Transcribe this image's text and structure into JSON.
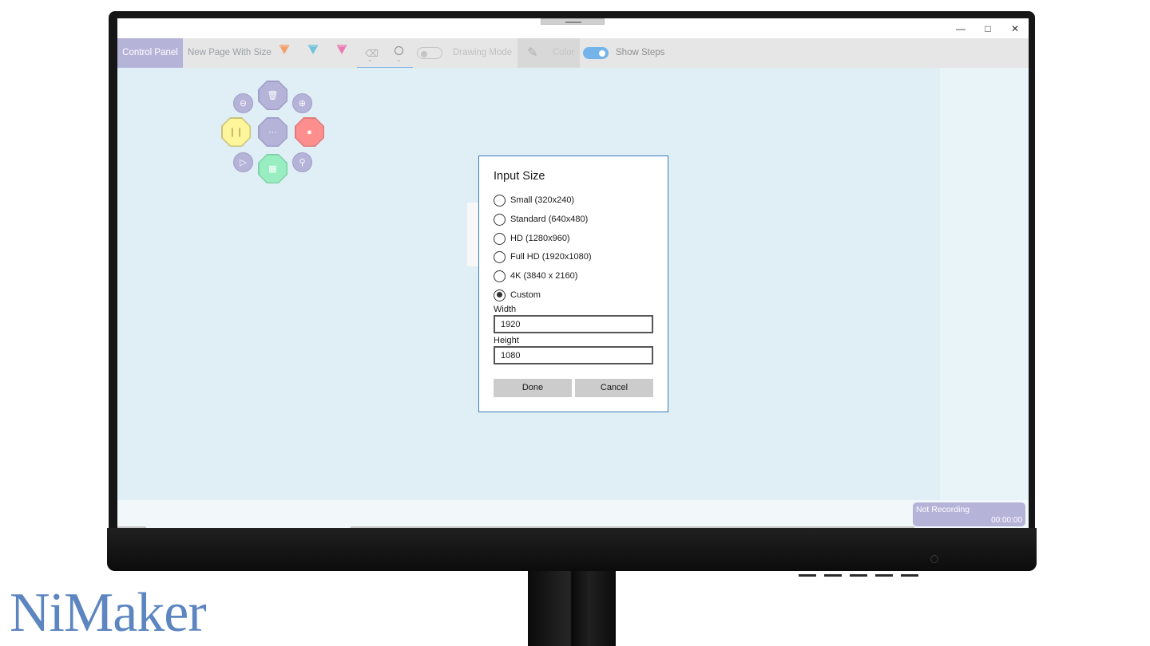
{
  "window": {
    "minimize_glyph": "—",
    "maximize_glyph": "□",
    "close_glyph": "✕"
  },
  "toolbar": {
    "control_panel_label": "Control Panel",
    "new_page_label": "New Page With Size",
    "drawing_mode_label": "Drawing Mode",
    "color_label": "Color",
    "show_steps_label": "Show Steps",
    "drawing_mode_on": false,
    "show_steps_on": true,
    "marker_colors": [
      "#f2a06b",
      "#6fc3da",
      "#e97ab5"
    ]
  },
  "control_pad": {
    "colors": {
      "purple": "#b6b3d9",
      "yellow": "#fff59a",
      "red": "#ff8f8f",
      "green": "#98edc1"
    },
    "icons": [
      "zoom-out-icon",
      "trash-icon",
      "zoom-in-icon",
      "pause-icon",
      "more-icon",
      "record-icon",
      "play-icon",
      "save-icon",
      "search-icon"
    ]
  },
  "dialog": {
    "title": "Input Size",
    "options": [
      {
        "label": "Small (320x240)",
        "selected": false
      },
      {
        "label": "Standard (640x480)",
        "selected": false
      },
      {
        "label": "HD (1280x960)",
        "selected": false
      },
      {
        "label": "Full HD (1920x1080)",
        "selected": false
      },
      {
        "label": "4K (3840 x 2160)",
        "selected": false
      },
      {
        "label": "Custom",
        "selected": true
      }
    ],
    "width_label": "Width",
    "width_value": "1920",
    "height_label": "Height",
    "height_value": "1080",
    "done_label": "Done",
    "cancel_label": "Cancel"
  },
  "status": {
    "recording_state": "Not Recording",
    "recording_time": "00:00:00"
  },
  "brand": {
    "logo_text": "NiMaker",
    "accent": "#b6b3d9",
    "toggle_on_color": "#74b4e8",
    "dialog_border": "#3b7bbf"
  }
}
